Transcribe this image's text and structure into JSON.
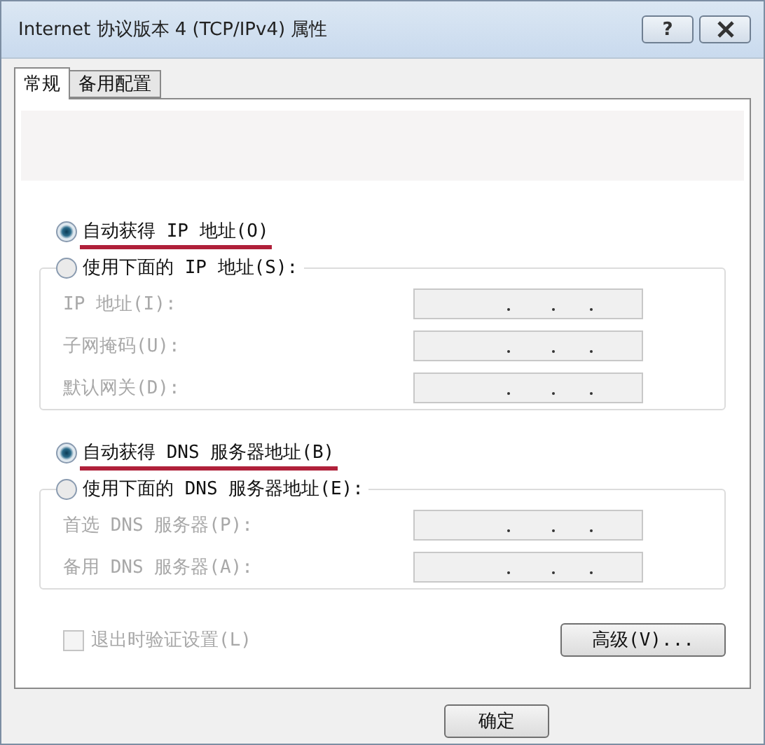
{
  "window": {
    "title": "Internet 协议版本 4 (TCP/IPv4) 属性",
    "help": "?"
  },
  "tabs": [
    {
      "label": "常规",
      "selected": true
    },
    {
      "label": "备用配置",
      "selected": false
    }
  ],
  "ip_section": {
    "options": [
      {
        "label": "自动获得 IP 地址(O)",
        "selected": true,
        "underlined": true
      },
      {
        "label": "使用下面的 IP 地址(S):",
        "selected": false,
        "underlined": false
      }
    ],
    "fields": [
      {
        "label": "IP 地址(I):",
        "disabled": true
      },
      {
        "label": "子网掩码(U):",
        "disabled": true
      },
      {
        "label": "默认网关(D):",
        "disabled": true
      }
    ]
  },
  "dns_section": {
    "options": [
      {
        "label": "自动获得 DNS 服务器地址(B)",
        "selected": true,
        "underlined": true
      },
      {
        "label": "使用下面的 DNS 服务器地址(E):",
        "selected": false,
        "underlined": false
      }
    ],
    "fields": [
      {
        "label": "首选 DNS 服务器(P):",
        "disabled": true
      },
      {
        "label": "备用 DNS 服务器(A):",
        "disabled": true
      }
    ]
  },
  "validate_checkbox": {
    "label": "退出时验证设置(L)",
    "checked": false,
    "disabled": true
  },
  "advanced_button": "高级(V)...",
  "footer_buttons": [
    "确定"
  ]
}
